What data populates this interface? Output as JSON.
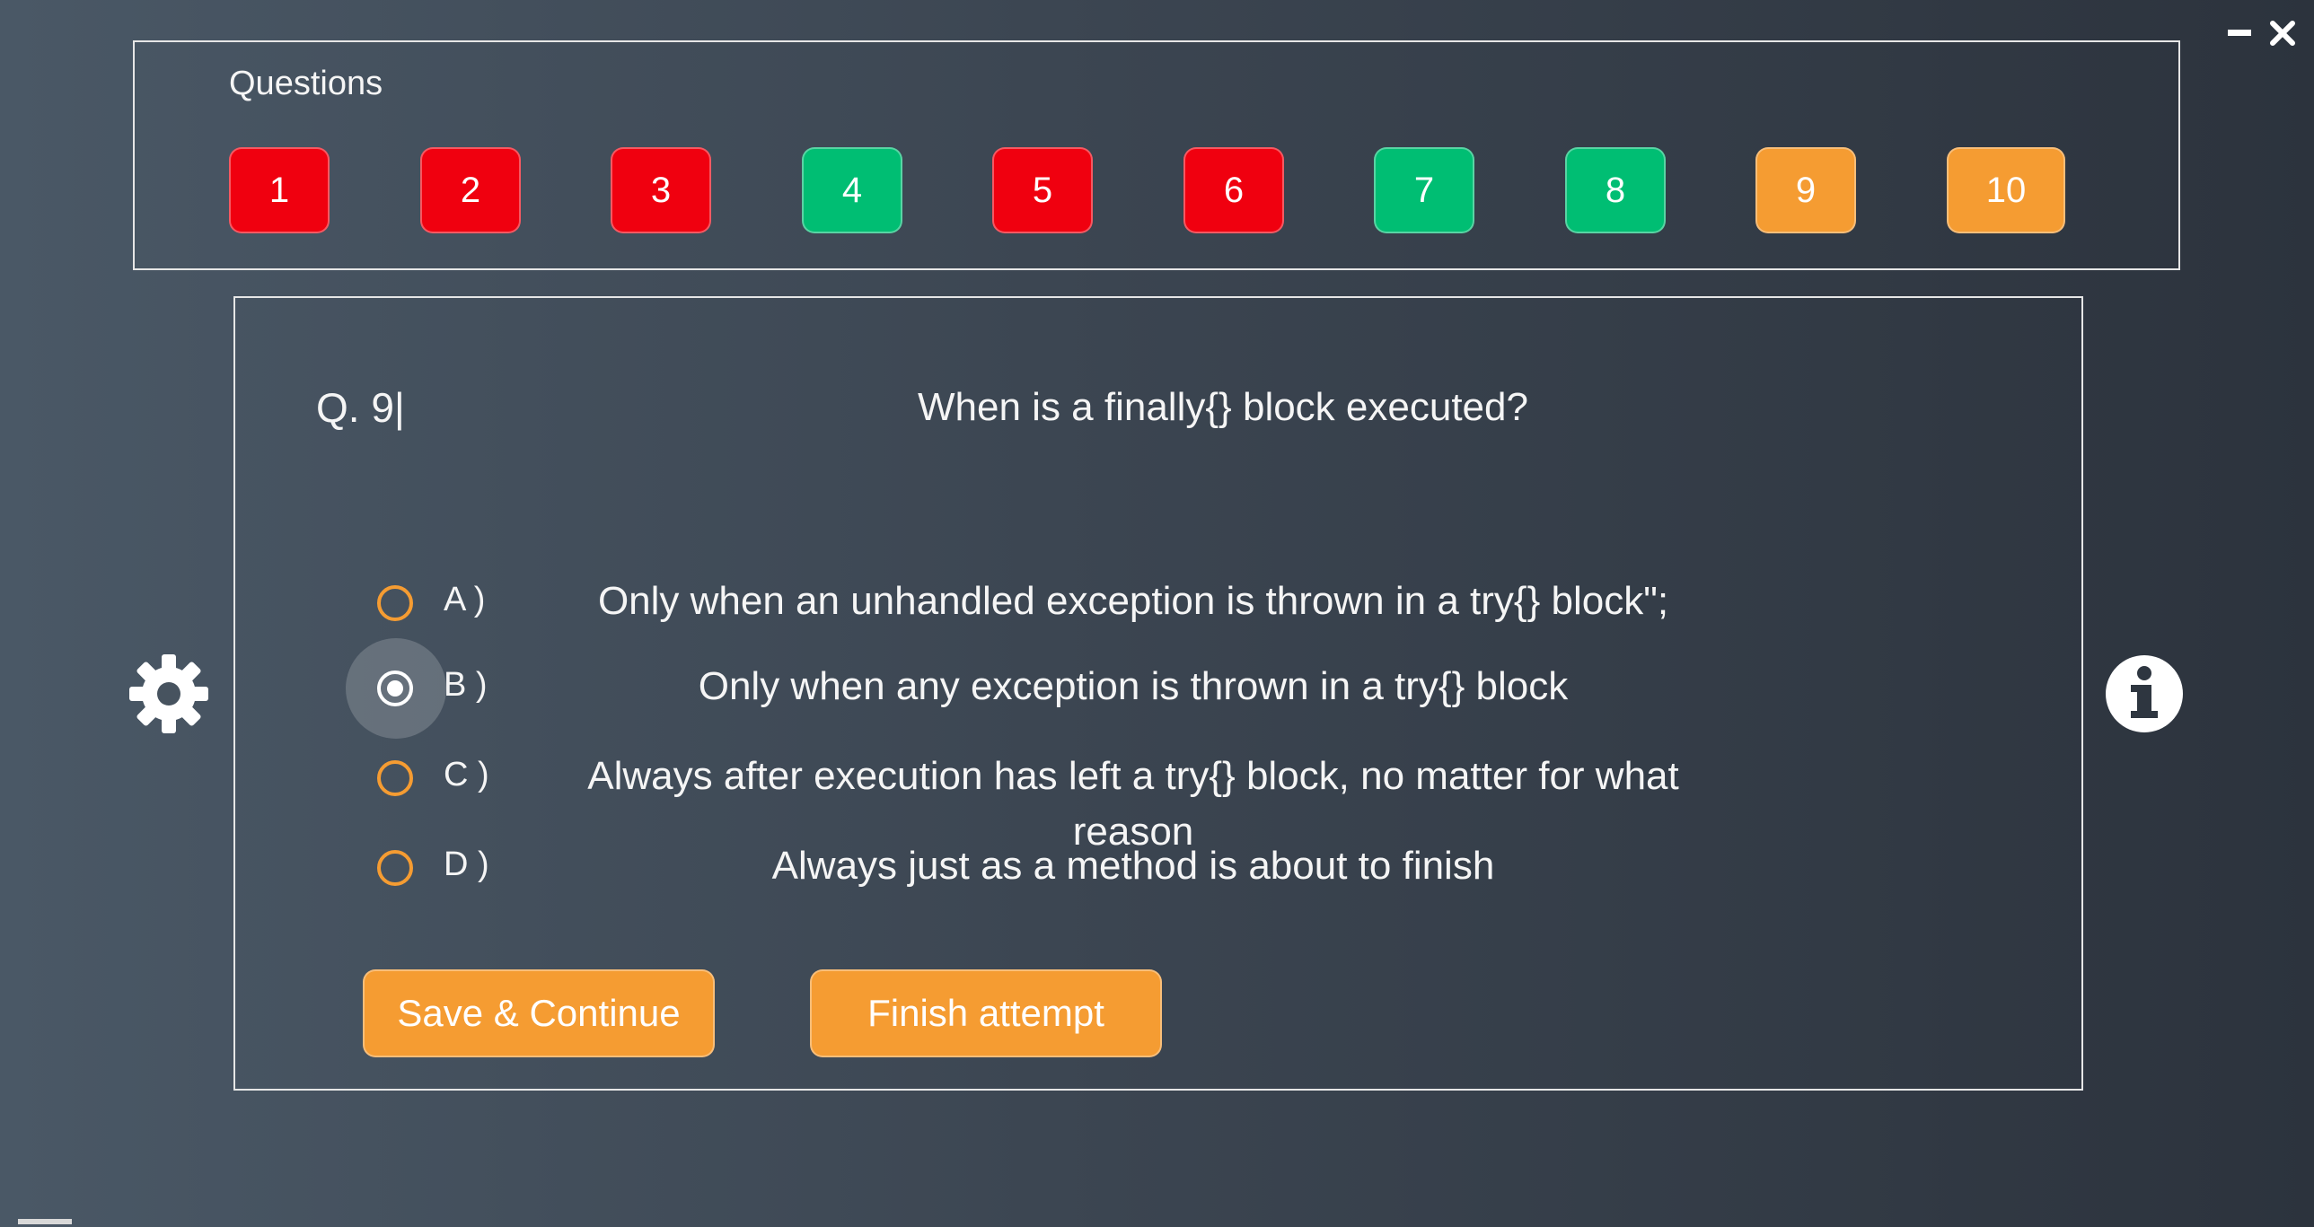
{
  "window": {
    "minimize_icon": "minimize-icon",
    "close_icon": "close-icon"
  },
  "questions_panel": {
    "title": "Questions",
    "items": [
      {
        "label": "1",
        "status": "red"
      },
      {
        "label": "2",
        "status": "red"
      },
      {
        "label": "3",
        "status": "red"
      },
      {
        "label": "4",
        "status": "green"
      },
      {
        "label": "5",
        "status": "red"
      },
      {
        "label": "6",
        "status": "red"
      },
      {
        "label": "7",
        "status": "green"
      },
      {
        "label": "8",
        "status": "green"
      },
      {
        "label": "9",
        "status": "orange"
      },
      {
        "label": "10",
        "status": "orange"
      }
    ]
  },
  "question": {
    "number": "Q. 9|",
    "text": "When is a finally{} block executed?",
    "options": [
      {
        "letter": "A )",
        "text": "Only when an unhandled exception is thrown in a try{} block\";",
        "selected": false
      },
      {
        "letter": "B )",
        "text": "Only when any exception is thrown in a try{} block",
        "selected": true
      },
      {
        "letter": "C )",
        "text": "Always after execution has left a try{} block, no matter for what reason",
        "selected": false
      },
      {
        "letter": "D )",
        "text": "Always just as a method is about to finish",
        "selected": false
      }
    ]
  },
  "actions": {
    "save_label": "Save & Continue",
    "finish_label": "Finish attempt"
  },
  "icons": {
    "settings": "gear-icon",
    "info": "info-icon"
  },
  "colors": {
    "status_red": "#f0000f",
    "status_green": "#00be73",
    "status_orange": "#f59c32",
    "accent": "#f59c32"
  }
}
